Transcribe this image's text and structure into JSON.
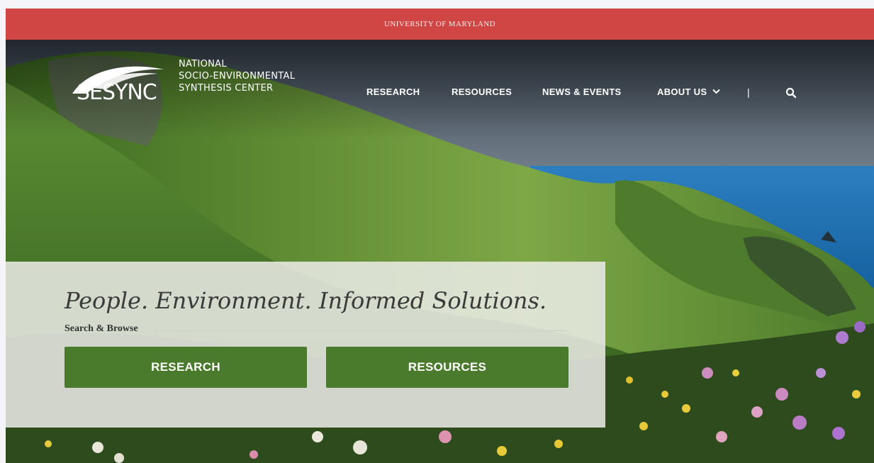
{
  "university_bar": {
    "label": "UNIVERSITY OF MARYLAND"
  },
  "brand": {
    "mark_text": "SESYNC",
    "name_lines": [
      "NATIONAL",
      "SOCIO-ENVIRONMENTAL",
      "SYNTHESIS CENTER"
    ]
  },
  "nav": {
    "items": [
      "RESEARCH",
      "RESOURCES",
      "NEWS & EVENTS",
      "ABOUT US"
    ],
    "separator": "|",
    "about_dropdown_icon": "chevron-down-icon",
    "search_icon": "search-icon"
  },
  "hero": {
    "tagline": "People. Environment. Informed Solutions.",
    "search_browse_label": "Search & Browse",
    "buttons": [
      "RESEARCH",
      "RESOURCES"
    ]
  },
  "colors": {
    "umd_red": "#cf4644",
    "button_green": "#4a7a2c"
  }
}
